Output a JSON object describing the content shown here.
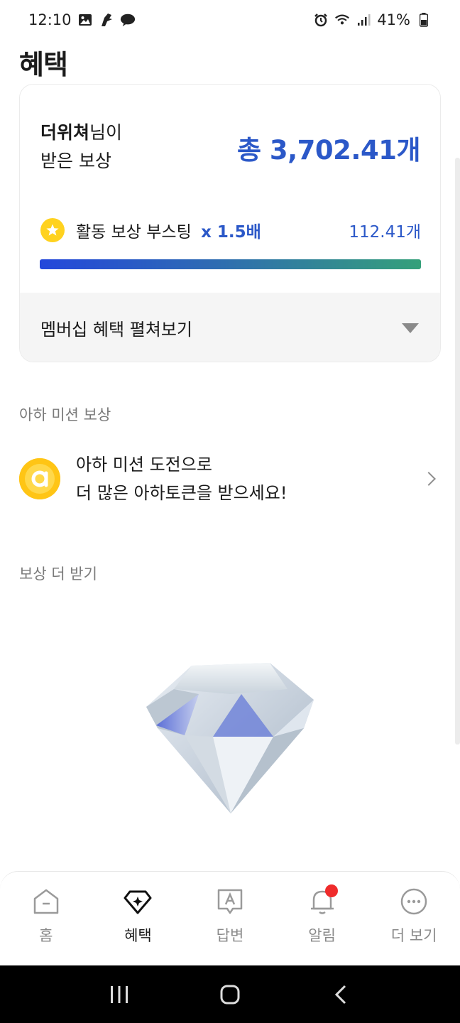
{
  "status_bar": {
    "time": "12:10",
    "battery": "41%",
    "left_icons": [
      "gallery-icon",
      "bird-icon",
      "chat-bubble-icon"
    ],
    "right_icons": [
      "alarm-icon",
      "wifi-icon",
      "signal-icon",
      "battery-icon"
    ]
  },
  "header": {
    "title": "혜택"
  },
  "reward_card": {
    "user_name": "더위쳐",
    "user_suffix": "님이",
    "received_label": "받은 보상",
    "total": "총 3,702.41개",
    "boost_label": "활동 보상 부스팅",
    "boost_multiplier": "x 1.5배",
    "boost_amount": "112.41개",
    "boost_progress": 1.0,
    "expand_label": "멤버십 혜택 펼쳐보기"
  },
  "mission_section": {
    "label": "아하 미션 보상",
    "line1": "아하 미션 도전으로",
    "line2": "더 많은 아하토큰을 받으세요!"
  },
  "more_section": {
    "label": "보상 더 받기"
  },
  "bottom_nav": {
    "items": [
      {
        "label": "홈",
        "icon": "home-icon",
        "active": false
      },
      {
        "label": "혜택",
        "icon": "diamond-icon",
        "active": true
      },
      {
        "label": "답변",
        "icon": "answer-icon",
        "active": false
      },
      {
        "label": "알림",
        "icon": "bell-icon",
        "active": false
      },
      {
        "label": "더 보기",
        "icon": "more-icon",
        "active": false
      }
    ]
  },
  "colors": {
    "accent": "#2b58c8",
    "star": "#ffd21f",
    "aha": "#ffc515",
    "notification": "#ef2b2b"
  }
}
